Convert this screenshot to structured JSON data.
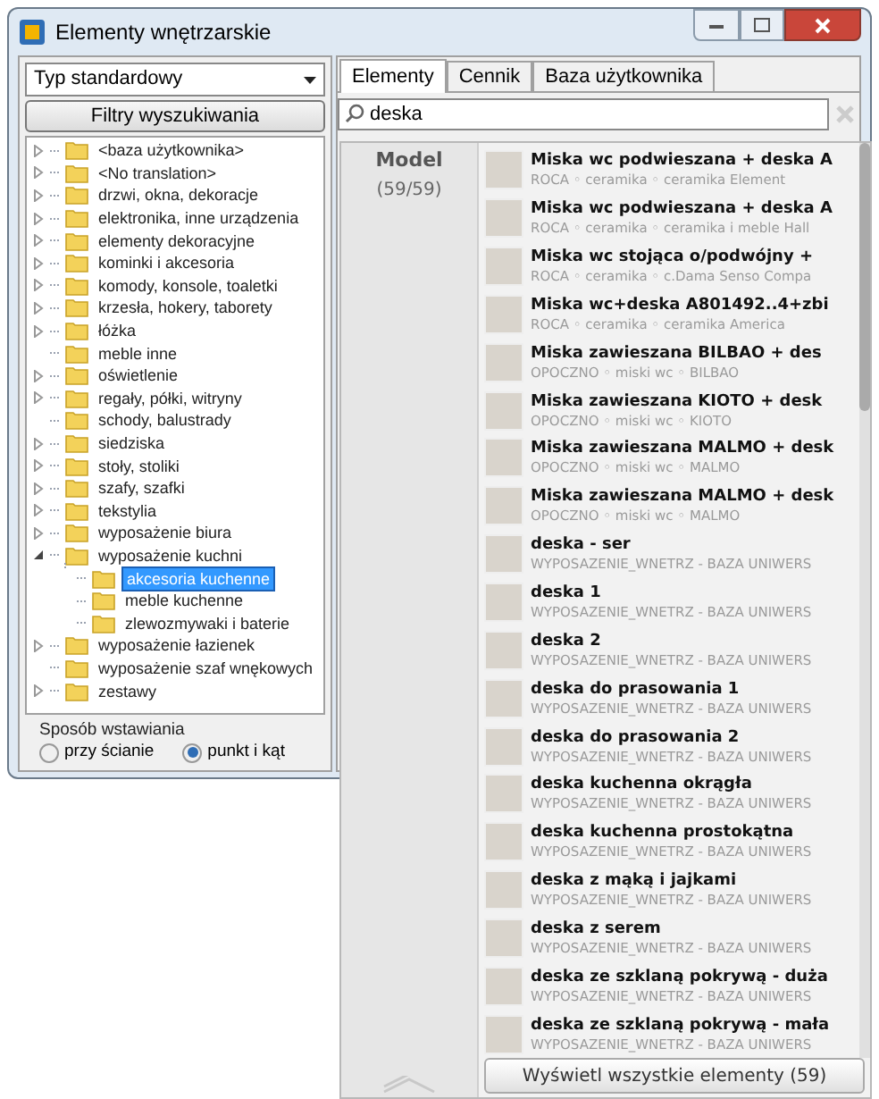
{
  "window": {
    "title": "Elementy wnętrzarskie"
  },
  "type_select": {
    "value": "Typ standardowy"
  },
  "filters_button": "Filtry wyszukiwania",
  "tree": [
    {
      "label": "<baza użytkownika>",
      "expandable": true,
      "expanded": false,
      "selected": false
    },
    {
      "label": "<No translation>",
      "expandable": true,
      "expanded": false,
      "selected": false
    },
    {
      "label": "drzwi, okna, dekoracje",
      "expandable": true,
      "expanded": false,
      "selected": false
    },
    {
      "label": "elektronika, inne urządzenia",
      "expandable": true,
      "expanded": false,
      "selected": false
    },
    {
      "label": "elementy dekoracyjne",
      "expandable": true,
      "expanded": false,
      "selected": false
    },
    {
      "label": "kominki i akcesoria",
      "expandable": true,
      "expanded": false,
      "selected": false
    },
    {
      "label": "komody, konsole, toaletki",
      "expandable": true,
      "expanded": false,
      "selected": false
    },
    {
      "label": "krzesła, hokery, taborety",
      "expandable": true,
      "expanded": false,
      "selected": false
    },
    {
      "label": "łóżka",
      "expandable": true,
      "expanded": false,
      "selected": false
    },
    {
      "label": "meble inne",
      "expandable": false,
      "expanded": false,
      "selected": false
    },
    {
      "label": "oświetlenie",
      "expandable": true,
      "expanded": false,
      "selected": false
    },
    {
      "label": "regały, półki, witryny",
      "expandable": true,
      "expanded": false,
      "selected": false
    },
    {
      "label": "schody, balustrady",
      "expandable": false,
      "expanded": false,
      "selected": false
    },
    {
      "label": "siedziska",
      "expandable": true,
      "expanded": false,
      "selected": false
    },
    {
      "label": "stoły, stoliki",
      "expandable": true,
      "expanded": false,
      "selected": false
    },
    {
      "label": "szafy, szafki",
      "expandable": true,
      "expanded": false,
      "selected": false
    },
    {
      "label": "tekstylia",
      "expandable": true,
      "expanded": false,
      "selected": false
    },
    {
      "label": "wyposażenie biura",
      "expandable": true,
      "expanded": false,
      "selected": false
    },
    {
      "label": "wyposażenie kuchni",
      "expandable": true,
      "expanded": true,
      "selected": false,
      "children": [
        {
          "label": "akcesoria kuchenne",
          "expandable": false,
          "expanded": false,
          "selected": true
        },
        {
          "label": "meble kuchenne",
          "expandable": false,
          "expanded": false,
          "selected": false
        },
        {
          "label": "zlewozmywaki i baterie",
          "expandable": false,
          "expanded": false,
          "selected": false
        }
      ]
    },
    {
      "label": "wyposażenie łazienek",
      "expandable": true,
      "expanded": false,
      "selected": false
    },
    {
      "label": "wyposażenie szaf wnękowych",
      "expandable": false,
      "expanded": false,
      "selected": false
    },
    {
      "label": "zestawy",
      "expandable": true,
      "expanded": false,
      "selected": false
    }
  ],
  "insertion": {
    "title": "Sposób wstawiania",
    "options": [
      {
        "label": "przy ścianie",
        "selected": false
      },
      {
        "label": "punkt i kąt",
        "selected": true
      }
    ]
  },
  "tabs": [
    {
      "label": "Elementy",
      "selected": true
    },
    {
      "label": "Cennik",
      "selected": false
    },
    {
      "label": "Baza użytkownika",
      "selected": false
    }
  ],
  "search": {
    "value": "deska"
  },
  "results": {
    "category": "Model",
    "count": "(59/59)",
    "items": [
      {
        "name": "Miska wc podwieszana + deska A",
        "path": "ROCA ◦ ceramika ◦ ceramika Element"
      },
      {
        "name": "Miska wc podwieszana + deska A",
        "path": "ROCA ◦ ceramika ◦ ceramika i meble Hall"
      },
      {
        "name": "Miska wc stojąca o/podwójny +",
        "path": "ROCA ◦ ceramika ◦ c.Dama Senso Compa"
      },
      {
        "name": "Miska wc+deska A801492..4+zbi",
        "path": "ROCA ◦ ceramika ◦ ceramika America"
      },
      {
        "name": "Miska zawieszana BILBAO + des",
        "path": "OPOCZNO ◦ miski wc ◦ BILBAO"
      },
      {
        "name": "Miska zawieszana KIOTO + desk",
        "path": "OPOCZNO ◦ miski wc ◦ KIOTO"
      },
      {
        "name": "Miska zawieszana MALMO + desk",
        "path": "OPOCZNO ◦ miski wc ◦ MALMO"
      },
      {
        "name": "Miska zawieszana MALMO + desk",
        "path": "OPOCZNO ◦ miski wc ◦ MALMO"
      },
      {
        "name": "deska - ser",
        "path": "WYPOSAZENIE_WNETRZ - BAZA UNIWERS"
      },
      {
        "name": "deska 1",
        "path": "WYPOSAZENIE_WNETRZ - BAZA UNIWERS"
      },
      {
        "name": "deska 2",
        "path": "WYPOSAZENIE_WNETRZ - BAZA UNIWERS"
      },
      {
        "name": "deska do prasowania 1",
        "path": "WYPOSAZENIE_WNETRZ - BAZA UNIWERS"
      },
      {
        "name": "deska do prasowania 2",
        "path": "WYPOSAZENIE_WNETRZ - BAZA UNIWERS"
      },
      {
        "name": "deska kuchenna okrągła",
        "path": "WYPOSAZENIE_WNETRZ - BAZA UNIWERS"
      },
      {
        "name": "deska kuchenna prostokątna",
        "path": "WYPOSAZENIE_WNETRZ - BAZA UNIWERS"
      },
      {
        "name": "deska z mąką i jajkami",
        "path": "WYPOSAZENIE_WNETRZ - BAZA UNIWERS"
      },
      {
        "name": "deska z serem",
        "path": "WYPOSAZENIE_WNETRZ - BAZA UNIWERS"
      },
      {
        "name": "deska ze szklaną pokrywą - duża",
        "path": "WYPOSAZENIE_WNETRZ - BAZA UNIWERS"
      },
      {
        "name": "deska ze szklaną pokrywą - mała",
        "path": "WYPOSAZENIE_WNETRZ - BAZA UNIWERS"
      }
    ],
    "show_all_button": "Wyświetl wszystkie elementy (59)"
  }
}
